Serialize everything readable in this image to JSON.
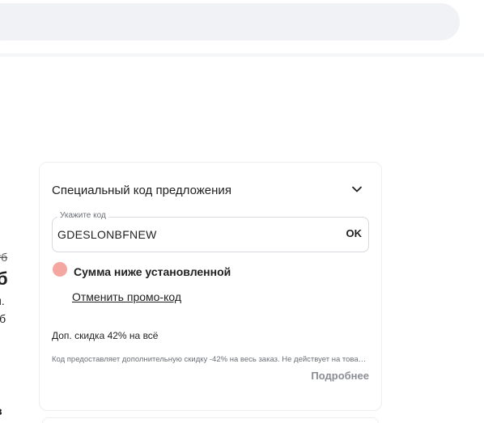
{
  "left_column": {
    "line1": "уб",
    "line2": "б",
    "line3": "и.",
    "line4": "уб",
    "line5": "в"
  },
  "promo": {
    "title": "Специальный код предложения",
    "field_label": "Укажите код",
    "code_value": "GDESLONBFNEW",
    "ok_label": "OK",
    "status_text": "Сумма ниже установленной",
    "cancel_label": "Отменить промо-код",
    "discount_title": "Доп. скидка 42% на всё",
    "discount_desc": "Код предоставляет дополнительную скидку -42% на весь заказ. Не действует на товары со скидкой",
    "more_label": "Подробнее"
  },
  "icons": {
    "chevron": "chevron-down-icon",
    "status": "status-circle-icon"
  },
  "colors": {
    "status_icon": "#f4a7a0",
    "search_bg": "#f1f2f5",
    "muted_text": "#8a8d93"
  }
}
